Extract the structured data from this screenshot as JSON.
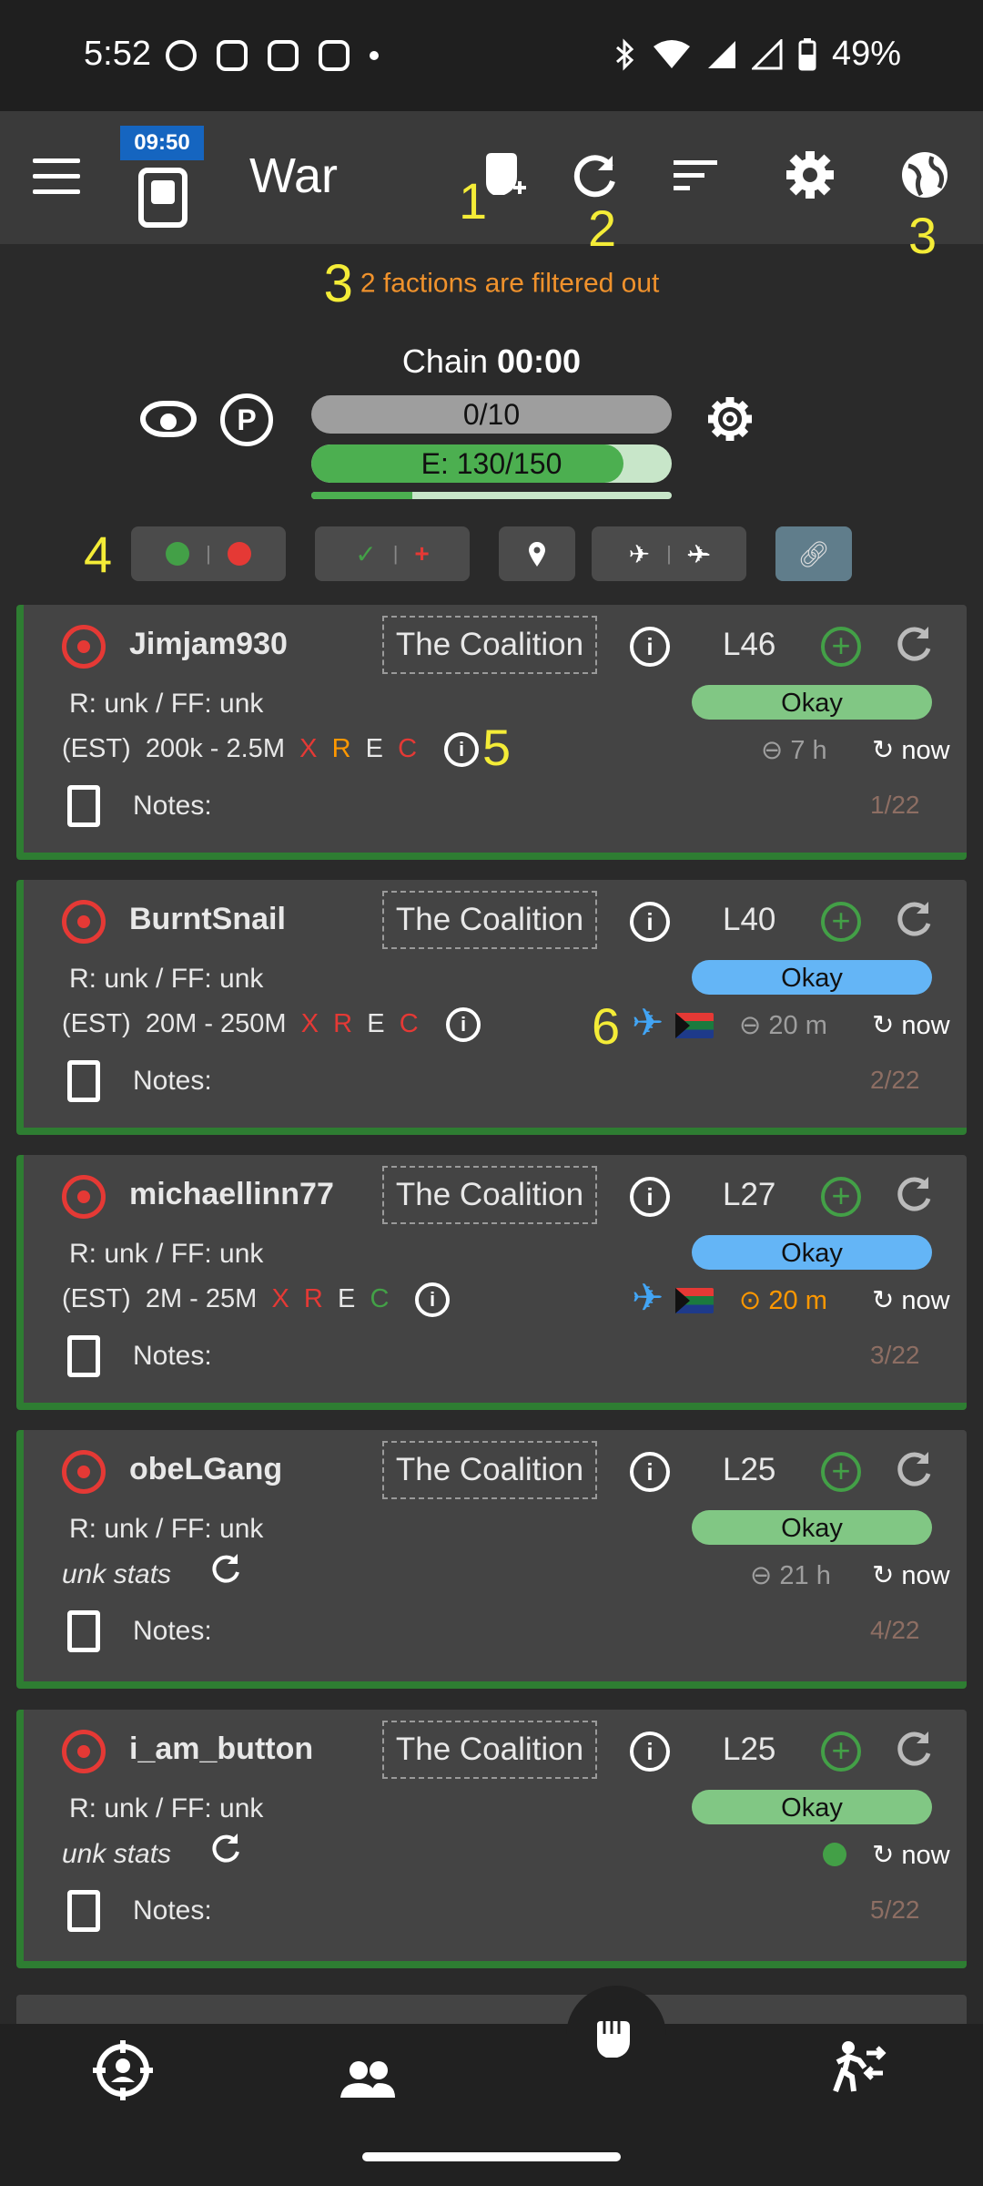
{
  "status_bar": {
    "time": "5:52",
    "battery": "49%",
    "notification_icons": [
      "whatsapp-icon",
      "slack-icon",
      "instagram-icon",
      "instagram-icon",
      "dot-icon"
    ],
    "system_icons": [
      "bluetooth-icon",
      "wifi-icon",
      "signal-icon",
      "signal-alert-icon",
      "battery-icon"
    ]
  },
  "app_bar": {
    "clock_badge": "09:50",
    "title": "War",
    "icons": [
      "menu-icon",
      "phone-icon",
      "war-fist-add-icon",
      "refresh-icon",
      "sort-icon",
      "settings-icon",
      "globe-icon"
    ],
    "annotations": [
      "1",
      "2",
      "3"
    ]
  },
  "filter_notice": {
    "annotation": "3",
    "text": "2 factions are filtered out"
  },
  "chain": {
    "label": "Chain ",
    "timer": "00:00",
    "progress_text": "0/10",
    "energy_text": "E: 130/150",
    "energy_fraction": 0.8667,
    "sub_fraction": 0.28
  },
  "filter_chips": {
    "annotation": "4",
    "chips": [
      "online-offline-dots",
      "check-plus",
      "location-pin-icon",
      "plane-noplane-icon",
      "link-icon"
    ]
  },
  "colors": {
    "okay_green": "#81c784",
    "okay_blue": "#64b5f6",
    "annotation_yellow": "#f4ec37",
    "faction_notice_orange": "#f0922c"
  },
  "targets": [
    {
      "name": "Jimjam930",
      "faction": "The Coalition",
      "level": "L46",
      "rff": "R: unk / FF: unk",
      "status": "Okay",
      "status_color": "#81c784",
      "est_prefix": "(EST)",
      "est_range": "200k - 2.5M",
      "est_x": "X",
      "est_r": "R",
      "est_e": "E",
      "est_c": "C",
      "annotation": "5",
      "timer": "7 h",
      "updated": "now",
      "notes": "Notes:",
      "count": "1/22"
    },
    {
      "name": "BurntSnail",
      "faction": "The Coalition",
      "level": "L40",
      "rff": "R: unk / FF: unk",
      "status": "Okay",
      "status_color": "#64b5f6",
      "est_prefix": "(EST)",
      "est_range": "20M - 250M",
      "est_x": "X",
      "est_r": "R",
      "est_e": "E",
      "est_c": "C",
      "annotation": "6",
      "timer": "20 m",
      "updated": "now",
      "notes": "Notes:",
      "count": "2/22"
    },
    {
      "name": "michaellinn77",
      "faction": "The Coalition",
      "level": "L27",
      "rff": "R: unk / FF: unk",
      "status": "Okay",
      "status_color": "#64b5f6",
      "est_prefix": "(EST)",
      "est_range": "2M - 25M",
      "est_x": "X",
      "est_r": "R",
      "est_e": "E",
      "est_c": "C",
      "timer": "20 m",
      "updated": "now",
      "notes": "Notes:",
      "count": "3/22"
    },
    {
      "name": "obeLGang",
      "faction": "The Coalition",
      "level": "L25",
      "rff": "R: unk / FF: unk",
      "status": "Okay",
      "status_color": "#81c784",
      "stats": "unk stats",
      "timer": "21 h",
      "updated": "now",
      "notes": "Notes:",
      "count": "4/22"
    },
    {
      "name": "i_am_button",
      "faction": "The Coalition",
      "level": "L25",
      "rff": "R: unk / FF: unk",
      "status": "Okay",
      "status_color": "#81c784",
      "stats": "unk stats",
      "updated": "now",
      "notes": "Notes:",
      "count": "5/22"
    }
  ],
  "bottom_nav": [
    "target-icon",
    "members-icon",
    "war-fist-icon",
    "running-icon"
  ]
}
